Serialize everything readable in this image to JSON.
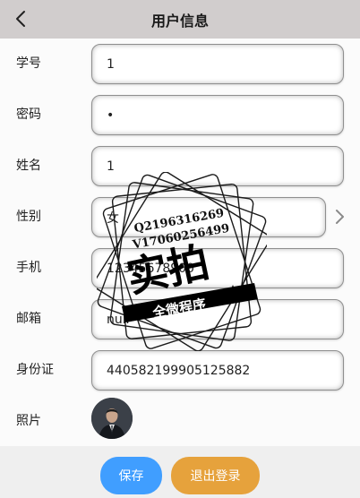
{
  "header": {
    "title": "用户信息",
    "back_icon": "chevron-left-icon"
  },
  "form": {
    "student_id": {
      "label": "学号",
      "value": "1"
    },
    "password": {
      "label": "密码",
      "value": "•"
    },
    "name": {
      "label": "姓名",
      "value": "1"
    },
    "gender": {
      "label": "性别",
      "value": "女"
    },
    "phone": {
      "label": "手机",
      "value": "12345678900"
    },
    "email": {
      "label": "邮箱",
      "value": "null"
    },
    "id_card": {
      "label": "身份证",
      "value": "440582199905125882"
    },
    "photo": {
      "label": "照片"
    }
  },
  "buttons": {
    "save": "保存",
    "logout": "退出登录"
  },
  "watermark": {
    "line1": "Q2196316269",
    "line2": "V17060256499",
    "main": "实拍",
    "ribbon": "全微程序"
  },
  "colors": {
    "header_bg": "#d1cdcd",
    "save_btn": "#409eff",
    "logout_btn": "#e6a23c",
    "footer_bg": "#efefef"
  }
}
